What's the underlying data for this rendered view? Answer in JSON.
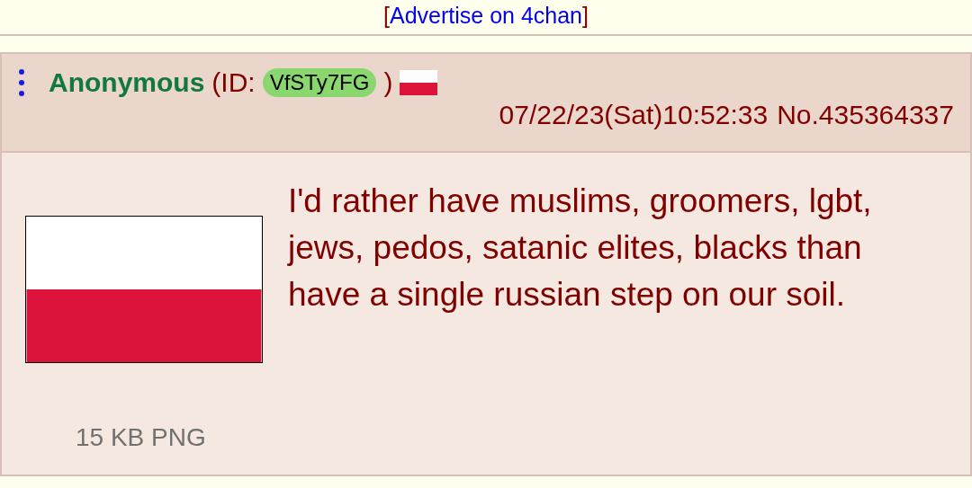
{
  "ad": {
    "open": "[",
    "label": "Advertise on 4chan",
    "close": "]"
  },
  "post": {
    "name": "Anonymous",
    "id_prefix": "(ID:",
    "id": "VfSTy7FG",
    "id_suffix": ")",
    "datetime": "07/22/23(Sat)10:52:33",
    "number": "No.435364337",
    "message": "I'd rather have muslims, groomers, lgbt, jews, pedos, satanic elites, blacks than have a single russian step on our soil.",
    "file_info": "15 KB PNG"
  }
}
